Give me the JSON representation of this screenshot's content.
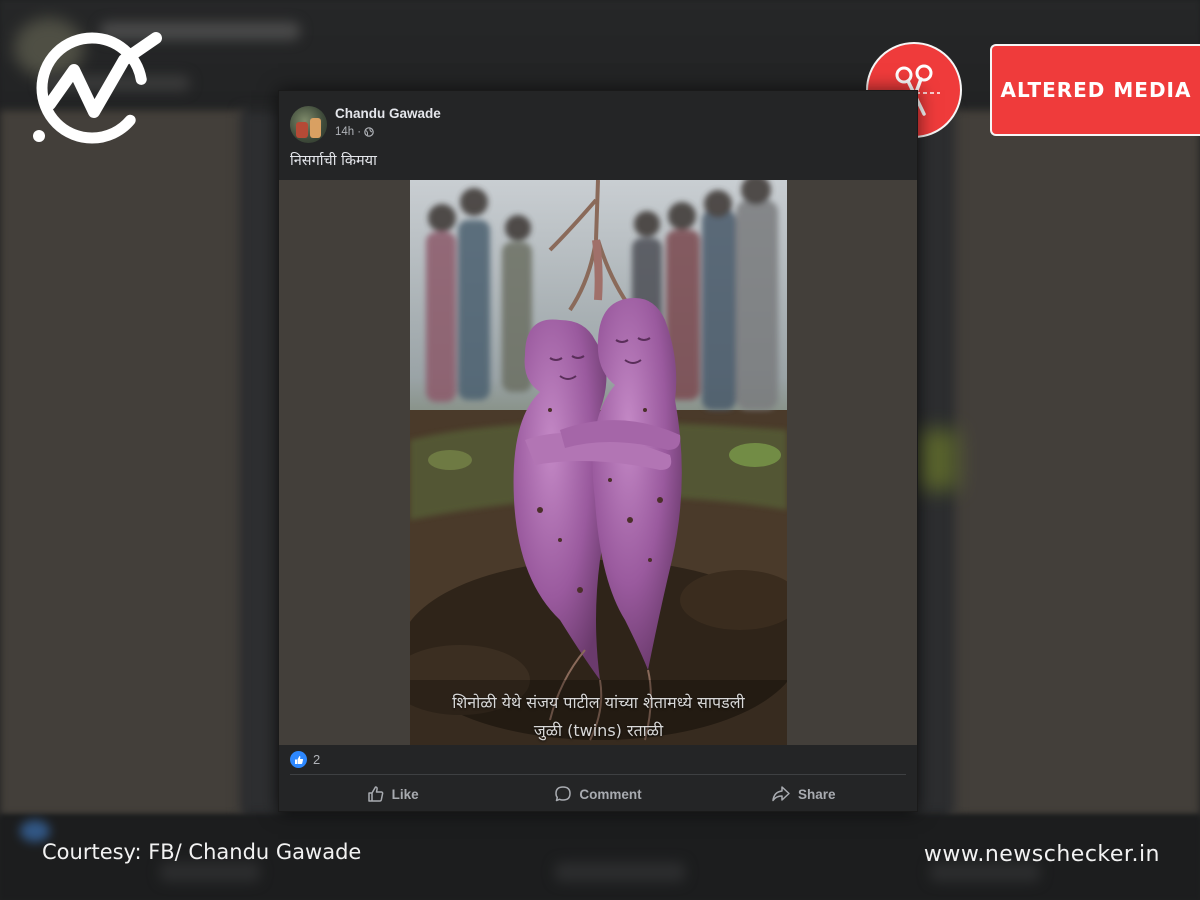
{
  "post": {
    "author": "Chandu Gawade",
    "time": "14h",
    "time_separator": "·",
    "caption": "निसर्गाची किमया",
    "media_subtitle_line1": "शिनोळी येथे संजय पाटील यांच्या शेतामध्ये सापडली",
    "media_subtitle_line2": "जुळी (twins) रताळी",
    "reaction_count": "2",
    "actions": {
      "like": "Like",
      "comment": "Comment",
      "share": "Share"
    }
  },
  "badge": {
    "label": "ALTERED MEDIA",
    "icon": "scissors-icon"
  },
  "logo": {
    "icon": "newschecker-check-logo"
  },
  "footer": {
    "courtesy": "Courtesy: FB/ Chandu Gawade",
    "website": "www.newschecker.in"
  },
  "colors": {
    "badge_red": "#ef3b3b",
    "facebook_blue": "#2d88ff",
    "card_background": "#242526",
    "media_background": "#433f3a"
  }
}
